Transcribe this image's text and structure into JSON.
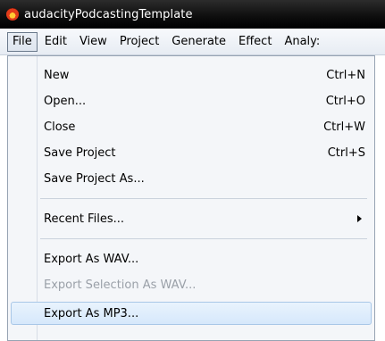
{
  "window": {
    "title": "audacityPodcastingTemplate"
  },
  "menubar": {
    "items": [
      "File",
      "Edit",
      "View",
      "Project",
      "Generate",
      "Effect",
      "Analy:"
    ]
  },
  "file_menu": {
    "items": [
      {
        "label": "New",
        "shortcut": "Ctrl+N"
      },
      {
        "label": "Open...",
        "shortcut": "Ctrl+O"
      },
      {
        "label": "Close",
        "shortcut": "Ctrl+W"
      },
      {
        "label": "Save Project",
        "shortcut": "Ctrl+S"
      },
      {
        "label": "Save Project As..."
      },
      {
        "label": "Recent Files..."
      },
      {
        "label": "Export As WAV..."
      },
      {
        "label": "Export Selection As WAV..."
      },
      {
        "label": "Export As MP3..."
      }
    ]
  },
  "colors": {
    "title_bar": "#000000",
    "menu_bg": "#f4f6f9",
    "highlight_border": "#a9c7e7",
    "disabled_text": "#9aa0a8"
  }
}
